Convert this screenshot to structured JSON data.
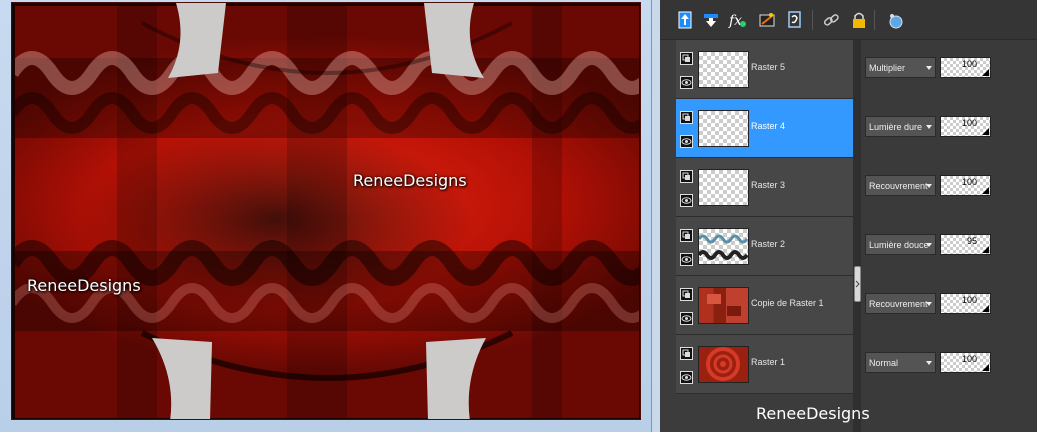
{
  "canvas": {
    "watermark_center": "ReneeDesigns",
    "watermark_left": "ReneeDesigns"
  },
  "toolbar": {
    "icons": [
      "new-layer-icon",
      "merge-down-icon",
      "effects-icon",
      "mask-icon",
      "duplicate-icon",
      "link-icon",
      "lock-icon",
      "visibility-toggle-icon"
    ]
  },
  "layers": [
    {
      "name": "Raster 5",
      "blend": "Multiplier",
      "opacity": "100",
      "selected": false,
      "thumb": "transparent"
    },
    {
      "name": "Raster 4",
      "blend": "Lumière dure",
      "opacity": "100",
      "selected": true,
      "thumb": "transparent"
    },
    {
      "name": "Raster 3",
      "blend": "Recouvrement",
      "opacity": "100",
      "selected": false,
      "thumb": "transparent"
    },
    {
      "name": "Raster 2",
      "blend": "Lumière douce",
      "opacity": "95",
      "selected": false,
      "thumb": "waves"
    },
    {
      "name": "Copie de Raster 1",
      "blend": "Recouvrement",
      "opacity": "100",
      "selected": false,
      "thumb": "red-tiles"
    },
    {
      "name": "Raster 1",
      "blend": "Normal",
      "opacity": "100",
      "selected": false,
      "thumb": "red-rings"
    }
  ],
  "palette": {
    "watermark": "ReneeDesigns"
  },
  "colors": {
    "selection": "#3399ff",
    "panel_bg": "#3c3c3c",
    "canvas_red": "#d81b0a"
  }
}
